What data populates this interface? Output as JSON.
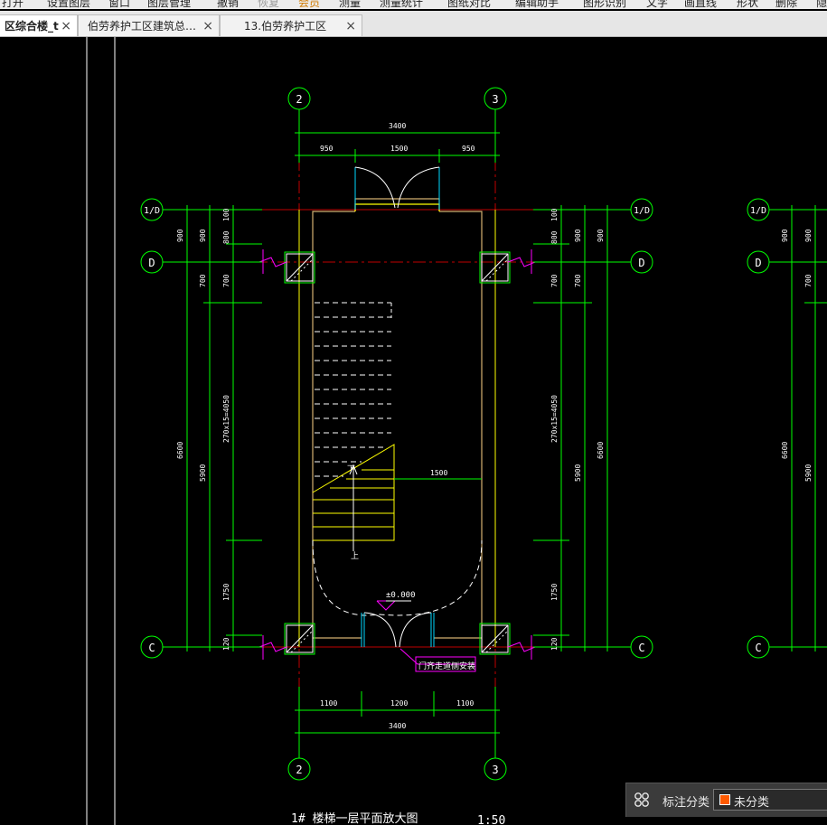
{
  "menu": {
    "items": [
      {
        "label": "打开",
        "state": "normal"
      },
      {
        "label": "设置图层",
        "state": "normal"
      },
      {
        "label": "窗口",
        "state": "normal"
      },
      {
        "label": "图层管理",
        "state": "normal"
      },
      {
        "label": "撤销",
        "state": "normal"
      },
      {
        "label": "恢复",
        "state": "disabled"
      },
      {
        "label": "会员",
        "state": "warn"
      },
      {
        "label": "测量",
        "state": "normal"
      },
      {
        "label": "测量统计",
        "state": "normal"
      },
      {
        "label": "图纸对比",
        "state": "normal"
      },
      {
        "label": "编辑助手",
        "state": "normal"
      },
      {
        "label": "图形识别",
        "state": "normal"
      },
      {
        "label": "文字",
        "state": "normal"
      },
      {
        "label": "画直线",
        "state": "normal"
      },
      {
        "label": "形状",
        "state": "normal"
      },
      {
        "label": "删除",
        "state": "normal"
      },
      {
        "label": "隐",
        "state": "normal"
      }
    ]
  },
  "tabs": [
    {
      "label": "区综合楼_t",
      "active": true
    },
    {
      "label": "伯劳养护工区建筑总…",
      "active": false
    },
    {
      "label": "13.伯劳养护工区",
      "active": false
    }
  ],
  "tab_close_glyph": "×",
  "drawing": {
    "axes": {
      "a2": "2",
      "a3": "3",
      "a1d": "1/D",
      "ad": "D",
      "ac": "C"
    },
    "dims": {
      "top_total": "3400",
      "top_left": "950",
      "top_mid": "1500",
      "top_right": "950",
      "bot_left": "1100",
      "bot_mid": "1200",
      "bot_right": "1100",
      "bot_total": "3400",
      "v900": "900",
      "v800": "800",
      "v700": "700",
      "v100": "100",
      "v6600": "6600",
      "v5900": "5900",
      "vstair": "270x15=4050",
      "v1750": "1750",
      "v120": "120",
      "landing": "1500"
    },
    "labels": {
      "up": "上",
      "down": "下",
      "level": "±0.000",
      "door_note": "门齐走道侧安装",
      "title": "1# 楼梯一层平面放大图",
      "scale": "1:50"
    },
    "colors": {
      "background": "#000000",
      "axis_green": "#00ff00",
      "wall_yellow": "#ffff00",
      "wall_tan": "#d4b070",
      "red_axis": "#ff0000",
      "door_cyan": "#00ffff",
      "magenta": "#ff00ff",
      "white": "#ffffff"
    }
  },
  "legend": {
    "label": "标注分类",
    "value": "未分类",
    "swatch_color": "#ff5a00"
  }
}
